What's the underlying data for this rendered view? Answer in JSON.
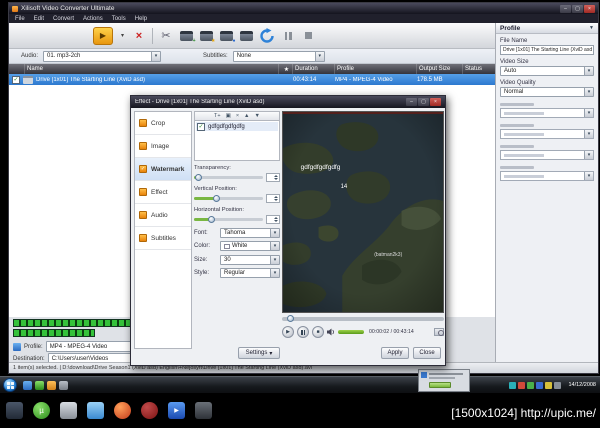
{
  "page": {
    "upic_label": "[1500x1024] http://upic.me/"
  },
  "icons": {
    "minimize": "–",
    "maximize": "▢",
    "close": "×",
    "dropdown": "▾",
    "panel_arrow": "▼",
    "convert": "▶",
    "delete": "×",
    "cut": "✂",
    "play": "▶",
    "stop": "■",
    "check": "✓",
    "star": "★",
    "add_text": "T+",
    "add_image": "▣",
    "remove": "×",
    "up": "▲",
    "down": "▼"
  },
  "main_window": {
    "title": "Xilisoft Video Converter Ultimate",
    "menu": [
      "File",
      "Edit",
      "Convert",
      "Actions",
      "Tools",
      "Help"
    ],
    "audio_label": "Audio:",
    "audio_value": "01. mp3-2ch",
    "subtitles_label": "Subtitles:",
    "subtitles_value": "None",
    "columns": [
      "Name",
      "Duration",
      "Profile",
      "Output Size",
      "Status"
    ],
    "row": {
      "name": "Drive [1x01] The Starting Line (XviD asd)",
      "duration": "00:43:14",
      "profile": "MP4 - MPEG-4 Video",
      "output_size": "178.5 MB",
      "status": ""
    },
    "profile_label": "Profile:",
    "profile_value": "MP4 - MPEG-4 Video",
    "destination_label": "Destination:",
    "destination_value": "C:\\Users\\user\\Videos",
    "status_bar": "1 item(s) selected. | D:\\download\\Drive Season1 (XviD asd) English\\+Nejosyft\\Drive [1x01] The Starting Line (XviD asd).avi"
  },
  "right_panel": {
    "header": "Profile",
    "file_name_label": "File Name",
    "file_name_value": "Drive [1x01] The Starting Line (XviD asd",
    "video_size_label": "Video Size",
    "video_size_value": "Auto",
    "video_quality_label": "Video Quality",
    "video_quality_value": "Normal"
  },
  "effect_dialog": {
    "title": "Effect - Drive [1x01] The Starting Line (XviD asd)",
    "tabs": [
      "Crop",
      "Image",
      "Watermark",
      "Effect",
      "Audio",
      "Subtitles"
    ],
    "watermark_item": "gdfgdfgdfgdfg",
    "transparency_label": "Transparency:",
    "vertical_label": "Vertical Position:",
    "horizontal_label": "Horizontal Position:",
    "font_label": "Font:",
    "font_value": "Tahoma",
    "color_label": "Color:",
    "color_value": "White",
    "size_label": "Size:",
    "size_value": "30",
    "style_label": "Style:",
    "style_value": "Regular",
    "settings_button": "Settings",
    "apply_button": "Apply",
    "close_button": "Close",
    "preview_watermark": "gdfgdfgdfgdfg",
    "preview_number": "14",
    "preview_credit": "(batman2k3)",
    "time_display": "00:00:02 / 00:43:14"
  },
  "taskbar": {
    "clock_date": "14/12/2008"
  }
}
